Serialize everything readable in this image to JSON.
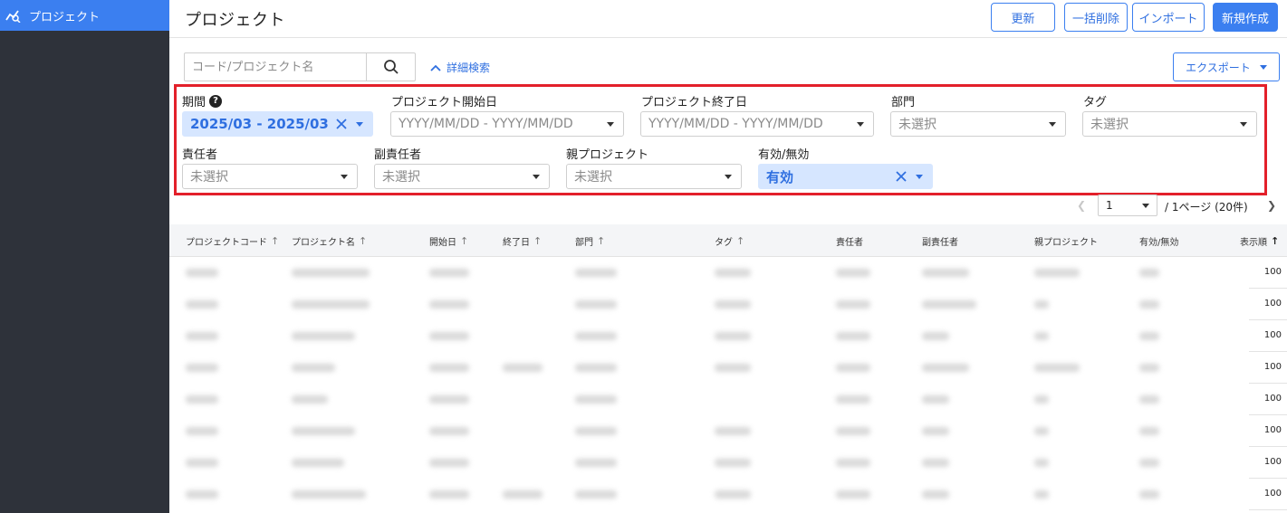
{
  "sidebar": {
    "items": [
      {
        "label": "プロジェクト",
        "icon": "project-chart-icon",
        "active": true
      }
    ]
  },
  "header": {
    "title": "プロジェクト",
    "buttons": {
      "refresh": "更新",
      "bulk_delete": "一括削除",
      "import": "インポート",
      "create": "新規作成"
    }
  },
  "toolbar": {
    "search_placeholder": "コード/プロジェクト名",
    "advanced_search": "詳細検索",
    "export": "エクスポート"
  },
  "filters": {
    "period": {
      "label": "期間",
      "help": "?",
      "value": "2025/03 - 2025/03"
    },
    "start_date": {
      "label": "プロジェクト開始日",
      "placeholder": "YYYY/MM/DD - YYYY/MM/DD"
    },
    "end_date": {
      "label": "プロジェクト終了日",
      "placeholder": "YYYY/MM/DD - YYYY/MM/DD"
    },
    "department": {
      "label": "部門",
      "placeholder": "未選択"
    },
    "tag": {
      "label": "タグ",
      "placeholder": "未選択"
    },
    "manager": {
      "label": "責任者",
      "placeholder": "未選択"
    },
    "sub_manager": {
      "label": "副責任者",
      "placeholder": "未選択"
    },
    "parent_project": {
      "label": "親プロジェクト",
      "placeholder": "未選択"
    },
    "active_status": {
      "label": "有効/無効",
      "value": "有効"
    }
  },
  "pagination": {
    "current_page": "1",
    "summary": "/ 1ページ (20件)"
  },
  "table": {
    "columns": [
      "プロジェクトコード",
      "プロジェクト名",
      "開始日",
      "終了日",
      "部門",
      "タグ",
      "責任者",
      "副責任者",
      "親プロジェクト",
      "有効/無効",
      "表示順"
    ],
    "rows": [
      {
        "display_order": "100"
      },
      {
        "display_order": "100"
      },
      {
        "display_order": "100"
      },
      {
        "display_order": "100"
      },
      {
        "display_order": "100"
      },
      {
        "display_order": "100"
      },
      {
        "display_order": "100"
      },
      {
        "display_order": "100"
      }
    ]
  },
  "colors": {
    "accent": "#3b7ff0",
    "sidebar_bg": "#2e323a",
    "highlight_border": "#e3202a",
    "chip_bg": "#d6e6ff"
  }
}
